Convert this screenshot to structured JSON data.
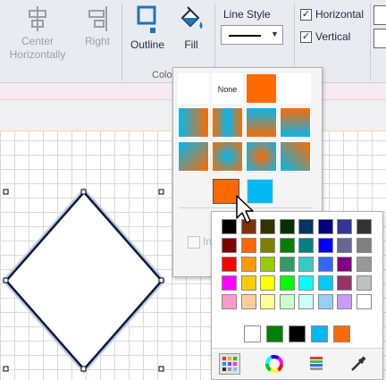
{
  "ribbon": {
    "center_horizontally_label": "Center Horizontally",
    "right_label": "Right",
    "outline_label": "Outline",
    "fill_label": "Fill",
    "line_style_label": "Line Style",
    "horizontal_label": "Horizontal",
    "vertical_label": "Vertical",
    "horizontal_checked": true,
    "vertical_checked": true,
    "group_label_partial": "Colo"
  },
  "fill_palette": {
    "none_label": "None",
    "obscured_checkbox_label": "In",
    "recent_colors": [
      "#ff6a00",
      "#00b8f2"
    ]
  },
  "standard_colors": {
    "rows": [
      [
        "#000000",
        "#7f3300",
        "#333300",
        "#003300",
        "#003366",
        "#000080",
        "#333399",
        "#333333"
      ],
      [
        "#800000",
        "#ff6600",
        "#808000",
        "#008000",
        "#008080",
        "#0000ff",
        "#666699",
        "#808080"
      ],
      [
        "#ff0000",
        "#ff9900",
        "#99cc00",
        "#339966",
        "#33cccc",
        "#3366ff",
        "#800080",
        "#999999"
      ],
      [
        "#ff00ff",
        "#ffcc00",
        "#ffff00",
        "#00ff00",
        "#00ffff",
        "#00ccff",
        "#993366",
        "#c0c0c0"
      ],
      [
        "#ff99cc",
        "#ffcc99",
        "#ffff99",
        "#ccffcc",
        "#ccffff",
        "#99ccff",
        "#cc99ff",
        "#ffffff"
      ]
    ],
    "recent": [
      "#ffffff",
      "#008000",
      "#000000",
      "#00b8f2",
      "#ff6a00"
    ]
  },
  "icons": {
    "tools": [
      "palette-grid-icon",
      "color-wheel-icon",
      "color-sliders-icon",
      "eyedropper-icon"
    ]
  },
  "colors": {
    "accent_orange": "#ff6a00",
    "accent_cyan": "#00b8f2",
    "ribbon_active": "#1b75bb"
  }
}
